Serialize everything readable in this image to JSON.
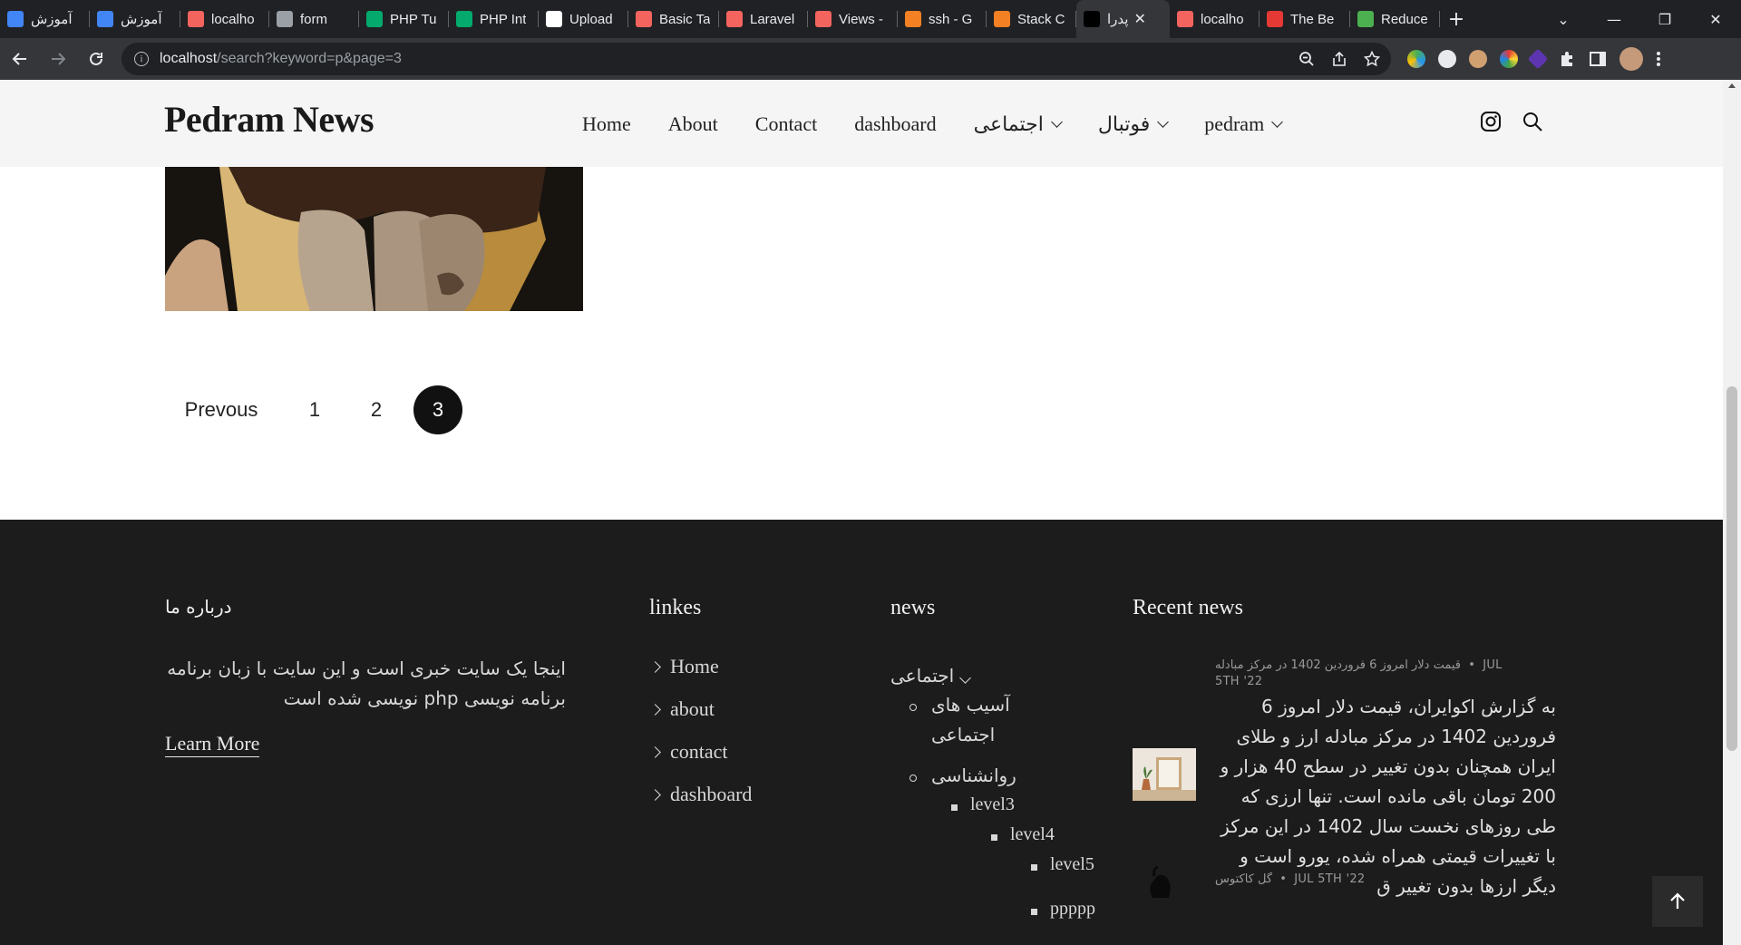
{
  "browser": {
    "tabs": [
      {
        "label": "آموزش",
        "favicon": "blue-doc-icon",
        "color": "#4285f4",
        "active": false
      },
      {
        "label": "آموزش",
        "favicon": "blue-doc-icon",
        "color": "#4285f4",
        "active": false
      },
      {
        "label": "localho",
        "favicon": "laravel-icon",
        "color": "#f4645f",
        "active": false
      },
      {
        "label": "form",
        "favicon": "globe-icon",
        "color": "#9aa0a6",
        "active": false
      },
      {
        "label": "PHP Tu",
        "favicon": "w3schools-icon",
        "color": "#04aa6d",
        "active": false
      },
      {
        "label": "PHP Int",
        "favicon": "w3schools-icon",
        "color": "#04aa6d",
        "active": false
      },
      {
        "label": "Upload",
        "favicon": "github-icon",
        "color": "#ffffff",
        "active": false
      },
      {
        "label": "Basic Ta",
        "favicon": "laravel-icon",
        "color": "#f4645f",
        "active": false
      },
      {
        "label": "Laravel",
        "favicon": "laravel-icon",
        "color": "#f4645f",
        "active": false
      },
      {
        "label": "Views -",
        "favicon": "laravel-icon",
        "color": "#f4645f",
        "active": false
      },
      {
        "label": "ssh - G",
        "favicon": "stackoverflow-icon",
        "color": "#f48024",
        "active": false
      },
      {
        "label": "Stack C",
        "favicon": "stackoverflow-icon",
        "color": "#f48024",
        "active": false
      },
      {
        "label": "پدرا",
        "favicon": "number-one-icon",
        "color": "#000000",
        "active": true
      },
      {
        "label": "localho",
        "favicon": "laravel-icon",
        "color": "#f4645f",
        "active": false
      },
      {
        "label": "The Be",
        "favicon": "target-icon",
        "color": "#e53935",
        "active": false
      },
      {
        "label": "Reduce",
        "favicon": "green-circle-icon",
        "color": "#4caf50",
        "active": false
      }
    ],
    "url_host": "localhost",
    "url_path": "/search?keyword=p&page=3"
  },
  "site": {
    "logo": "Pedram News",
    "nav": [
      {
        "label": "Home",
        "dropdown": false
      },
      {
        "label": "About",
        "dropdown": false
      },
      {
        "label": "Contact",
        "dropdown": false
      },
      {
        "label": "dashboard",
        "dropdown": false
      },
      {
        "label": "اجتماعی",
        "dropdown": true
      },
      {
        "label": "فوتبال",
        "dropdown": true
      },
      {
        "label": "pedram",
        "dropdown": true
      }
    ]
  },
  "pagination": {
    "previous": "Prevous",
    "pages": [
      "1",
      "2",
      "3"
    ],
    "current": "3"
  },
  "footer": {
    "about": {
      "title": "درباره ما",
      "text": "اینجا یک سایت خبری است و این سایت با زبان برنامه برنامه نویسی php نویسی شده است",
      "learn_more": "Learn More"
    },
    "links": {
      "title": "linkes",
      "items": [
        "Home",
        "about",
        "contact",
        "dashboard"
      ]
    },
    "news": {
      "title": "news",
      "root": "اجتماعی",
      "sub1": "آسیب های",
      "sub1b": "اجتماعی",
      "sub2": "روانشناسی",
      "level3": "level3",
      "level4": "level4",
      "level5": "level5",
      "ppppp": "ppppp"
    },
    "recent": {
      "title": "Recent news",
      "item1_meta_date_a": "JUL",
      "item1_meta_date_b": "5TH '22",
      "item1_meta_tag": "قیمت دلار امروز 6 فروردین 1402 در مرکز مبادله",
      "item1_body": "به گزارش اکوایران، قیمت دلار امروز 6 فروردین 1402 در مرکز مبادله ارز و طلای ایران همچنان بدون تغییر در سطح 40 هزار و 200 تومان باقی مانده است. تنها ارزی که طی روزهای نخست سال 1402 در این مرکز با تغییرات قیمتی همراه شده، یورو است و دیگر ارزها بدون تغییر ق",
      "item2_meta_date": "JUL 5TH '22",
      "item2_meta_tag": "گل کاکتوس"
    }
  }
}
